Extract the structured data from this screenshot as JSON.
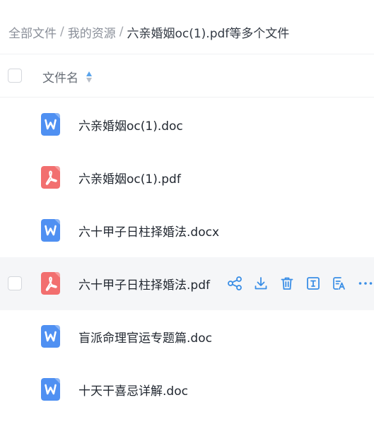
{
  "breadcrumb": {
    "items": [
      "全部文件",
      "我的资源"
    ],
    "separator": "/",
    "current": "六亲婚姻oc(1).pdf等多个文件"
  },
  "table": {
    "column_name": "文件名"
  },
  "files": [
    {
      "name": "六亲婚姻oc(1).doc",
      "type": "word"
    },
    {
      "name": "六亲婚姻oc(1).pdf",
      "type": "pdf"
    },
    {
      "name": "六十甲子日柱择婚法.docx",
      "type": "word"
    },
    {
      "name": "六十甲子日柱择婚法.pdf",
      "type": "pdf",
      "hovered": true
    },
    {
      "name": "盲派命理官运专题篇.doc",
      "type": "word"
    },
    {
      "name": "十天干喜忌详解.doc",
      "type": "word"
    }
  ],
  "row_actions": [
    "share-icon",
    "download-icon",
    "trash-icon",
    "rename-icon",
    "translate-icon",
    "more-icon"
  ],
  "colors": {
    "word": "#4f90f2",
    "pdf": "#f26f6f",
    "accent": "#3a8ee6",
    "hover_row": "#f5f6f8"
  }
}
